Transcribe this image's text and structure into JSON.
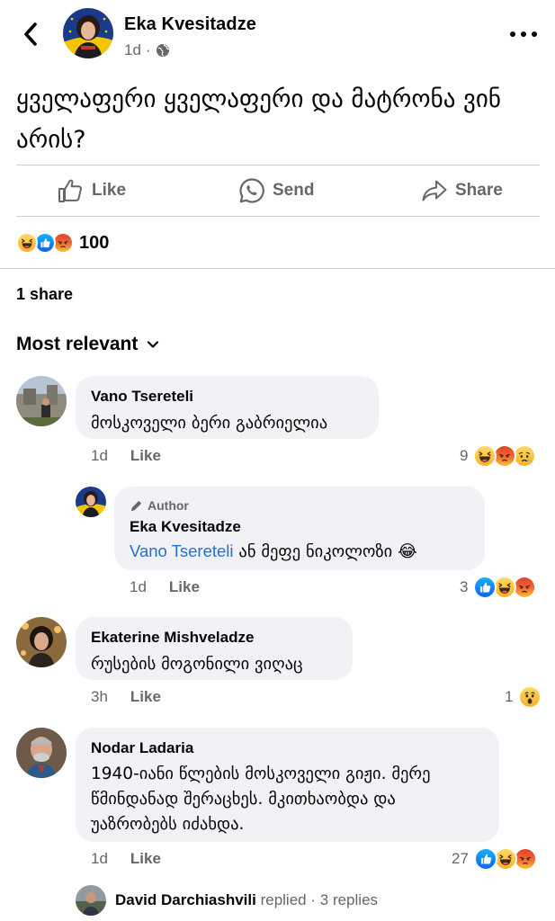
{
  "post": {
    "author": "Eka Kvesitadze",
    "time": "1d",
    "separator": "·",
    "privacy_icon": "globe-icon",
    "text": "ყველაფერი ყველაფერი და მატრონა ვინ არის?"
  },
  "actions": {
    "like": "Like",
    "send": "Send",
    "share": "Share"
  },
  "reactions": {
    "icons": [
      "haha-icon",
      "like-icon",
      "angry-icon"
    ],
    "count": "100"
  },
  "shares": "1 share",
  "sort": {
    "label": "Most relevant"
  },
  "comments": [
    {
      "name": "Vano Tsereteli",
      "text": "მოსკოველი ბერი გაბრიელია",
      "time": "1d",
      "like": "Like",
      "reaction_count": "9",
      "reaction_icons": [
        "haha-icon",
        "angry-icon",
        "sad-icon"
      ]
    },
    {
      "badge": "Author",
      "name": "Eka Kvesitadze",
      "mention": "Vano Tsereteli",
      "text": "ან მეფე ნიკოლოზი",
      "emoji": "😂",
      "time": "1d",
      "like": "Like",
      "reaction_count": "3",
      "reaction_icons": [
        "like-icon",
        "haha-icon",
        "angry-icon"
      ]
    },
    {
      "name": "Ekaterine Mishveladze",
      "text": "რუსების მოგონილი ვიღაც",
      "time": "3h",
      "like": "Like",
      "reaction_count": "1",
      "reaction_icons": [
        "wow-icon"
      ]
    },
    {
      "name": "Nodar Ladaria",
      "text_lines": [
        "1940-იანი წლების მოსკოველი გიჟი. მერე",
        "წმინდანად შერაცხეს. მკითხაობდა და",
        "უაზრობებს იძახდა."
      ],
      "time": "1d",
      "like": "Like",
      "reaction_count": "27",
      "reaction_icons": [
        "like-icon",
        "haha-icon",
        "angry-icon"
      ]
    }
  ],
  "replies": {
    "name": "David Darchiashvili",
    "action": "replied",
    "separator": "·",
    "count": "3 replies"
  },
  "colors": {
    "link": "#216fdb",
    "like_blue": "#1877f2",
    "bubble": "#f0f2f5",
    "muted": "#65676b"
  }
}
